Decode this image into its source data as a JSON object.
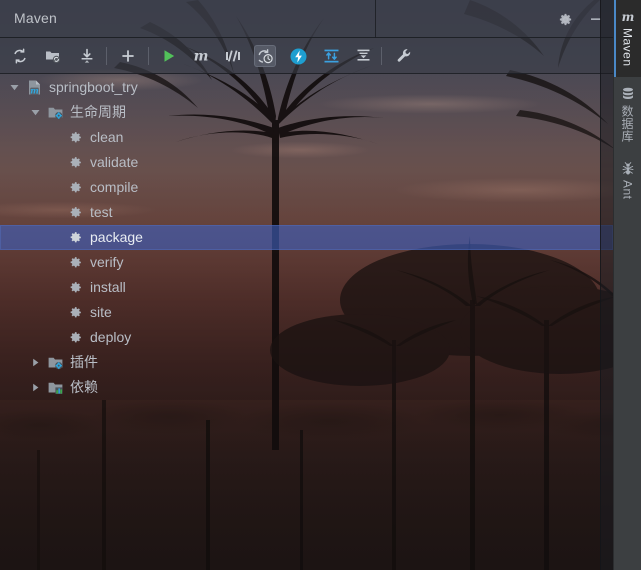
{
  "window": {
    "title": "Maven",
    "gear_icon": "gear-icon",
    "minimize_icon": "minimize-icon"
  },
  "toolbar": {
    "buttons": [
      {
        "name": "reload-all-maven-projects",
        "icon": "refresh-icon",
        "label": "Reload All Maven Projects",
        "active": false
      },
      {
        "name": "generate-sources-update-folders",
        "icon": "folder-refresh-icon",
        "label": "Generate Sources and Update Folders",
        "active": false
      },
      {
        "name": "download-sources-documentation",
        "icon": "download-icon",
        "label": "Download Sources and/or Documentation",
        "active": false
      },
      {
        "name": "add-maven-project",
        "icon": "plus-icon",
        "label": "Add Maven Projects",
        "active": false
      },
      {
        "name": "run-maven-build",
        "icon": "run-green-triangle-icon",
        "label": "Run Maven Build",
        "active": false
      },
      {
        "name": "execute-maven-goal",
        "icon": "maven-m-icon",
        "label": "Execute Maven Goal",
        "active": false
      },
      {
        "name": "toggle-skip-tests",
        "icon": "skip-tests-icon",
        "label": "Toggle Skip Tests Mode",
        "active": false
      },
      {
        "name": "toggle-offline-mode",
        "icon": "offline-clock-icon",
        "label": "Toggle Offline Mode",
        "active": true
      },
      {
        "name": "show-dependencies",
        "icon": "lightning-blue-icon",
        "label": "Show Dependencies",
        "active": false
      },
      {
        "name": "expand-all",
        "icon": "expand-all-icon",
        "label": "Expand All",
        "active": false
      },
      {
        "name": "collapse-all",
        "icon": "collapse-all-icon",
        "label": "Collapse All",
        "active": false
      },
      {
        "name": "maven-settings",
        "icon": "wrench-icon",
        "label": "Maven Settings",
        "active": false
      }
    ],
    "separator_positions": [
      106,
      148,
      381
    ]
  },
  "tree": {
    "nodes": [
      {
        "label": "springboot_try",
        "icon": "maven-project-icon",
        "arrow": "expanded",
        "indent": 0,
        "selected": false
      },
      {
        "label": "生命周期",
        "icon": "lifecycle-folder-icon",
        "arrow": "expanded",
        "indent": 1,
        "selected": false
      },
      {
        "label": "clean",
        "icon": "goal-gear-icon",
        "arrow": "none",
        "indent": 2,
        "selected": false
      },
      {
        "label": "validate",
        "icon": "goal-gear-icon",
        "arrow": "none",
        "indent": 2,
        "selected": false
      },
      {
        "label": "compile",
        "icon": "goal-gear-icon",
        "arrow": "none",
        "indent": 2,
        "selected": false
      },
      {
        "label": "test",
        "icon": "goal-gear-icon",
        "arrow": "none",
        "indent": 2,
        "selected": false
      },
      {
        "label": "package",
        "icon": "goal-gear-icon",
        "arrow": "none",
        "indent": 2,
        "selected": true
      },
      {
        "label": "verify",
        "icon": "goal-gear-icon",
        "arrow": "none",
        "indent": 2,
        "selected": false
      },
      {
        "label": "install",
        "icon": "goal-gear-icon",
        "arrow": "none",
        "indent": 2,
        "selected": false
      },
      {
        "label": "site",
        "icon": "goal-gear-icon",
        "arrow": "none",
        "indent": 2,
        "selected": false
      },
      {
        "label": "deploy",
        "icon": "goal-gear-icon",
        "arrow": "none",
        "indent": 2,
        "selected": false
      },
      {
        "label": "插件",
        "icon": "plugins-folder-icon",
        "arrow": "collapsed",
        "indent": 1,
        "selected": false
      },
      {
        "label": "依赖",
        "icon": "dependencies-folder-icon",
        "arrow": "collapsed",
        "indent": 1,
        "selected": false
      }
    ]
  },
  "right_tool_strip": {
    "tabs": [
      {
        "label": "Maven",
        "icon": "maven-m-icon",
        "selected": true
      },
      {
        "label": "数据库",
        "icon": "database-icon",
        "selected": false
      },
      {
        "label": "Ant",
        "icon": "ant-bug-icon",
        "selected": false
      }
    ]
  },
  "colors": {
    "selection_blue": "#3e60be",
    "accent_blue": "#4a88c7",
    "run_green": "#52c15a",
    "panel_gray": "#3c3f41",
    "text_gray": "#b9bec6"
  }
}
